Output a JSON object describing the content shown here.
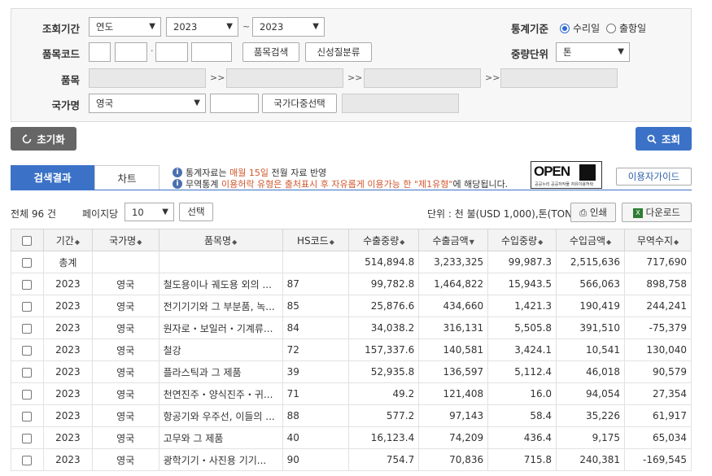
{
  "search": {
    "period_label": "조회기간",
    "period_type": "연도",
    "year_from": "2023",
    "tilde": "~",
    "year_to": "2023",
    "stat_basis_label": "통계기준",
    "radio_export": "수리일",
    "radio_import": "출항일",
    "item_code_label": "품목코드",
    "dot": "·",
    "item_search_btn": "품목검색",
    "new_nature_btn": "신성질분류",
    "weight_unit_label": "중량단위",
    "weight_unit": "톤",
    "item_label": "품목",
    "arrows": ">>",
    "country_label": "국가명",
    "country": "영국",
    "multi_country_btn": "국가다중선택"
  },
  "actions": {
    "reset": "초기화",
    "search": "조회"
  },
  "tabs": {
    "result": "검색결과",
    "chart": "차트"
  },
  "notices": {
    "line1_pre": "통계자료는 ",
    "line1_hl": "매월 15일",
    "line1_post": " 전월 자료 반영",
    "line2_pre": "무역통계 ",
    "line2_hl": "이용허락 유형은 출처표시 후 자유롭게 이용가능 한 \"제1유형\"",
    "line2_post": "에 해당됩니다."
  },
  "open_badge": {
    "text": "OPEN",
    "sub": "공공누리 공공저작물 자유이용허락"
  },
  "guide_btn": "이용자가이드",
  "toolbar": {
    "total": "전체 96 건",
    "per_page_label": "페이지당",
    "per_page": "10",
    "choose_btn": "선택",
    "unit": "단위 : 천 불(USD 1,000),톤(TON)",
    "print_btn": "인쇄",
    "download_btn": "다운로드"
  },
  "table": {
    "headers": [
      "기간",
      "국가명",
      "품목명",
      "HS코드",
      "수출중량",
      "수출금액",
      "수입중량",
      "수입금액",
      "무역수지"
    ],
    "total_row": [
      "총계",
      "",
      "",
      "",
      "514,894.8",
      "3,233,325",
      "99,987.3",
      "2,515,636",
      "717,690"
    ],
    "rows": [
      [
        "2023",
        "영국",
        "철도용이나 궤도용 외의 ...",
        "87",
        "99,782.8",
        "1,464,822",
        "15,943.5",
        "566,063",
        "898,758"
      ],
      [
        "2023",
        "영국",
        "전기기기와 그 부분품, 녹...",
        "85",
        "25,876.6",
        "434,660",
        "1,421.3",
        "190,419",
        "244,241"
      ],
      [
        "2023",
        "영국",
        "원자로・보일러・기계류...",
        "84",
        "34,038.2",
        "316,131",
        "5,505.8",
        "391,510",
        "-75,379"
      ],
      [
        "2023",
        "영국",
        "철강",
        "72",
        "157,337.6",
        "140,581",
        "3,424.1",
        "10,541",
        "130,040"
      ],
      [
        "2023",
        "영국",
        "플라스틱과 그 제품",
        "39",
        "52,935.8",
        "136,597",
        "5,112.4",
        "46,018",
        "90,579"
      ],
      [
        "2023",
        "영국",
        "천연진주・양식진주・귀...",
        "71",
        "49.2",
        "121,408",
        "16.0",
        "94,054",
        "27,354"
      ],
      [
        "2023",
        "영국",
        "항공기와 우주선, 이들의 ...",
        "88",
        "577.2",
        "97,143",
        "58.4",
        "35,226",
        "61,917"
      ],
      [
        "2023",
        "영국",
        "고무와 그 제품",
        "40",
        "16,123.4",
        "74,209",
        "436.4",
        "9,175",
        "65,034"
      ],
      [
        "2023",
        "영국",
        "광학기기・사진용 기기...",
        "90",
        "754.7",
        "70,836",
        "715.8",
        "240,381",
        "-169,545"
      ]
    ]
  }
}
